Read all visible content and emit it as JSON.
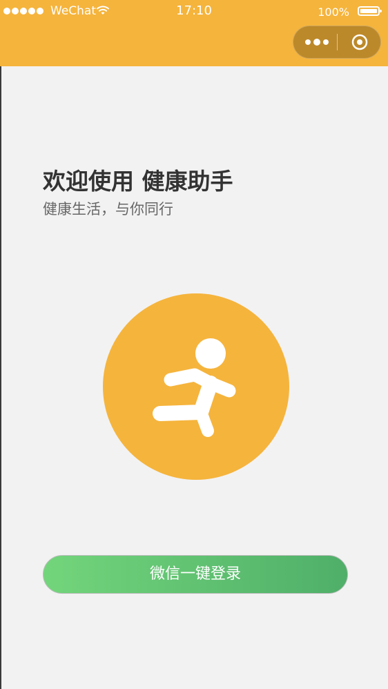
{
  "status_bar": {
    "carrier": "WeChat",
    "time": "17:10",
    "battery": "100%"
  },
  "nav": {
    "more_icon": "more-dots-icon",
    "close_icon": "target-close-icon",
    "color": "#f5b43c"
  },
  "welcome": {
    "title": "欢迎使用 健康助手",
    "subtitle": "健康生活，与你同行"
  },
  "hero": {
    "icon": "running-person-icon",
    "color": "#f5b43c"
  },
  "login": {
    "label": "微信一键登录",
    "gradient_start": "#73d57b",
    "gradient_end": "#4faf69"
  },
  "colors": {
    "page_background": "#f2f2f2",
    "title_text": "#333333",
    "subtitle_text": "#666666"
  }
}
